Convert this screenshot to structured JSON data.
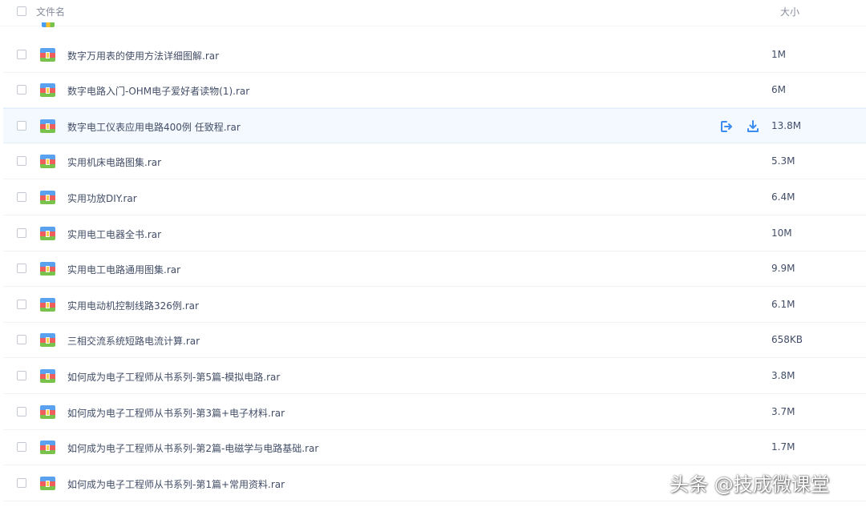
{
  "header": {
    "name_label": "文件名",
    "size_label": "大小"
  },
  "files": [
    {
      "name": "数字万用表的使用方法详细图解.rar",
      "size": "1M"
    },
    {
      "name": "数字电路入门-OHM电子爱好者读物(1).rar",
      "size": "6M"
    },
    {
      "name": "数字电工仪表应用电路400例 任致程.rar",
      "size": "13.8M"
    },
    {
      "name": "实用机床电路图集.rar",
      "size": "5.3M"
    },
    {
      "name": "实用功放DIY.rar",
      "size": "6.4M"
    },
    {
      "name": "实用电工电器全书.rar",
      "size": "10M"
    },
    {
      "name": "实用电工电路通用图集.rar",
      "size": "9.9M"
    },
    {
      "name": "实用电动机控制线路326例.rar",
      "size": "6.1M"
    },
    {
      "name": "三相交流系统短路电流计算.rar",
      "size": "658KB"
    },
    {
      "name": "如何成为电子工程师从书系列-第5篇-模拟电路.rar",
      "size": "3.8M"
    },
    {
      "name": "如何成为电子工程师从书系列-第3篇+电子材料.rar",
      "size": "3.7M"
    },
    {
      "name": "如何成为电子工程师从书系列-第2篇-电磁学与电路基础.rar",
      "size": "1.7M"
    },
    {
      "name": "如何成为电子工程师从书系列-第1篇+常用资料.rar",
      "size": ""
    }
  ],
  "watermark": "头条 @技成微课堂",
  "colors": {
    "accent": "#3b8cf0",
    "hover_row": "#f4f9ff"
  },
  "icons": {
    "file": "rar-archive-icon",
    "share": "share-icon",
    "download": "download-icon"
  }
}
